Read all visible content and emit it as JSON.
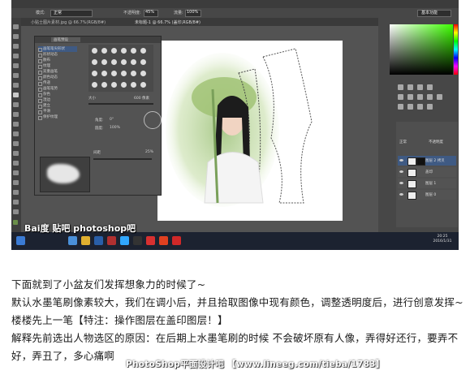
{
  "ps": {
    "doc_tab_1": "小贴士图片素材.jpg @ 66.7%(RGB/8#)",
    "doc_tab_2": "未标题-1 @ 66.7% (盖印,RGB/8#)",
    "opt_mode_label": "模式:",
    "opt_mode_value": "正常",
    "opt_opacity_label": "不透明度:",
    "opt_opacity_value": "45%",
    "opt_flow_label": "流量:",
    "opt_flow_value": "100%",
    "workspace": "基本功能",
    "brush_panel": {
      "tab": "画笔预设",
      "items": [
        "画笔笔尖形状",
        "形状动态",
        "散布",
        "纹理",
        "双重画笔",
        "颜色动态",
        "传递",
        "画笔笔势",
        "杂色",
        "湿边",
        "建立",
        "平滑",
        "保护纹理"
      ],
      "size_label": "大小",
      "size_value": "600 像素",
      "angle_label": "角度:",
      "angle_value": "0°",
      "roundness_label": "圆度:",
      "roundness_value": "100%",
      "spacing_label": "间距",
      "spacing_value": "25%"
    },
    "layers": {
      "mode": "正常",
      "opacity_label": "不透明度",
      "rows": [
        "图层 2 拷贝",
        "盖印",
        "图层 1",
        "图层 0"
      ]
    },
    "tray_time": "20:25",
    "tray_date": "2016/1/31"
  },
  "screenshot_watermark": "Bai度 贴吧  photoshop吧",
  "article": {
    "p1": "下面就到了小盆友们发挥想象力的时候了~",
    "p2": "默认水墨笔刷像素较大，我们在调小后，并且拾取图像中现有颜色，调整透明度后，进行创意发挥~楼楼先上一笔【特注：操作图层在盖印图层！】",
    "p3": "解释先前选出人物选区的原因：在后期上水墨笔刷的时候 不会破坏原有人像，弄得好还行，要弄不好，弄丑了，多心痛啊"
  },
  "footer_watermark": "PhotoShop平面设计吧 【www.lineeg.com/tieba/1783】"
}
